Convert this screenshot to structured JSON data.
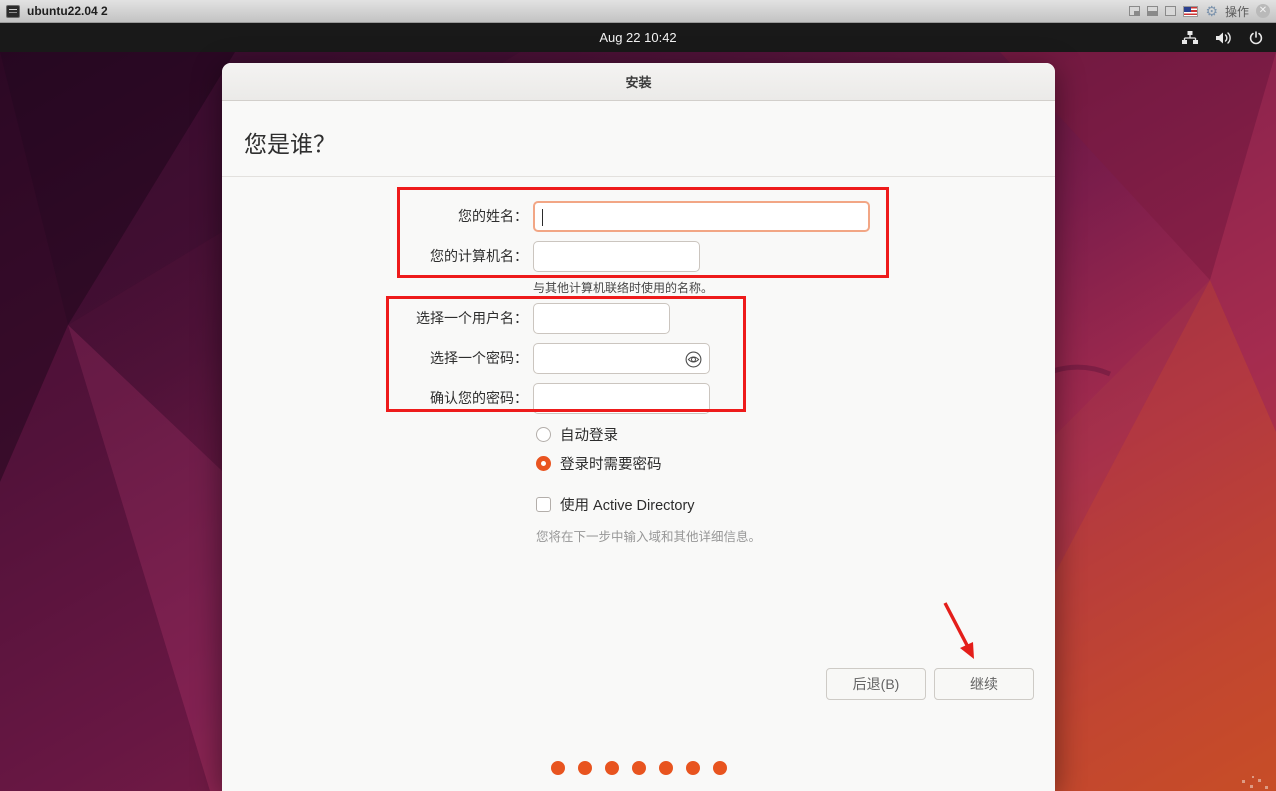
{
  "vm_titlebar": {
    "title": "ubuntu22.04 2",
    "actions_label": "操作",
    "close_glyph": "✕",
    "gear_glyph": "⚙"
  },
  "top_bar": {
    "clock": "Aug 22  10:42",
    "icons": [
      "network-icon",
      "volume-icon",
      "power-icon"
    ]
  },
  "installer": {
    "window_title": "安装",
    "page_title": "您是谁？",
    "fields": {
      "name": {
        "label": "您的姓名：",
        "value": "",
        "focused": true
      },
      "computer": {
        "label": "您的计算机名：",
        "value": "",
        "hint": "与其他计算机联络时使用的名称。"
      },
      "username": {
        "label": "选择一个用户名：",
        "value": ""
      },
      "password": {
        "label": "选择一个密码：",
        "value": "",
        "reveal_icon": "eye-icon"
      },
      "confirm": {
        "label": "确认您的密码：",
        "value": ""
      }
    },
    "options": {
      "auto_login": {
        "label": "自动登录",
        "selected": false
      },
      "password_login": {
        "label": "登录时需要密码",
        "selected": true
      },
      "active_directory": {
        "label": "使用 Active Directory",
        "checked": false,
        "hint": "您将在下一步中输入域和其他详细信息。"
      }
    },
    "buttons": {
      "back": "后退(B)",
      "continue": "继续"
    },
    "progress_dots": 7
  },
  "colors": {
    "accent_orange": "#e95420",
    "annotation_red": "#ee1b1b",
    "focus_border": "#f2a685",
    "topbar_bg": "#191919"
  }
}
